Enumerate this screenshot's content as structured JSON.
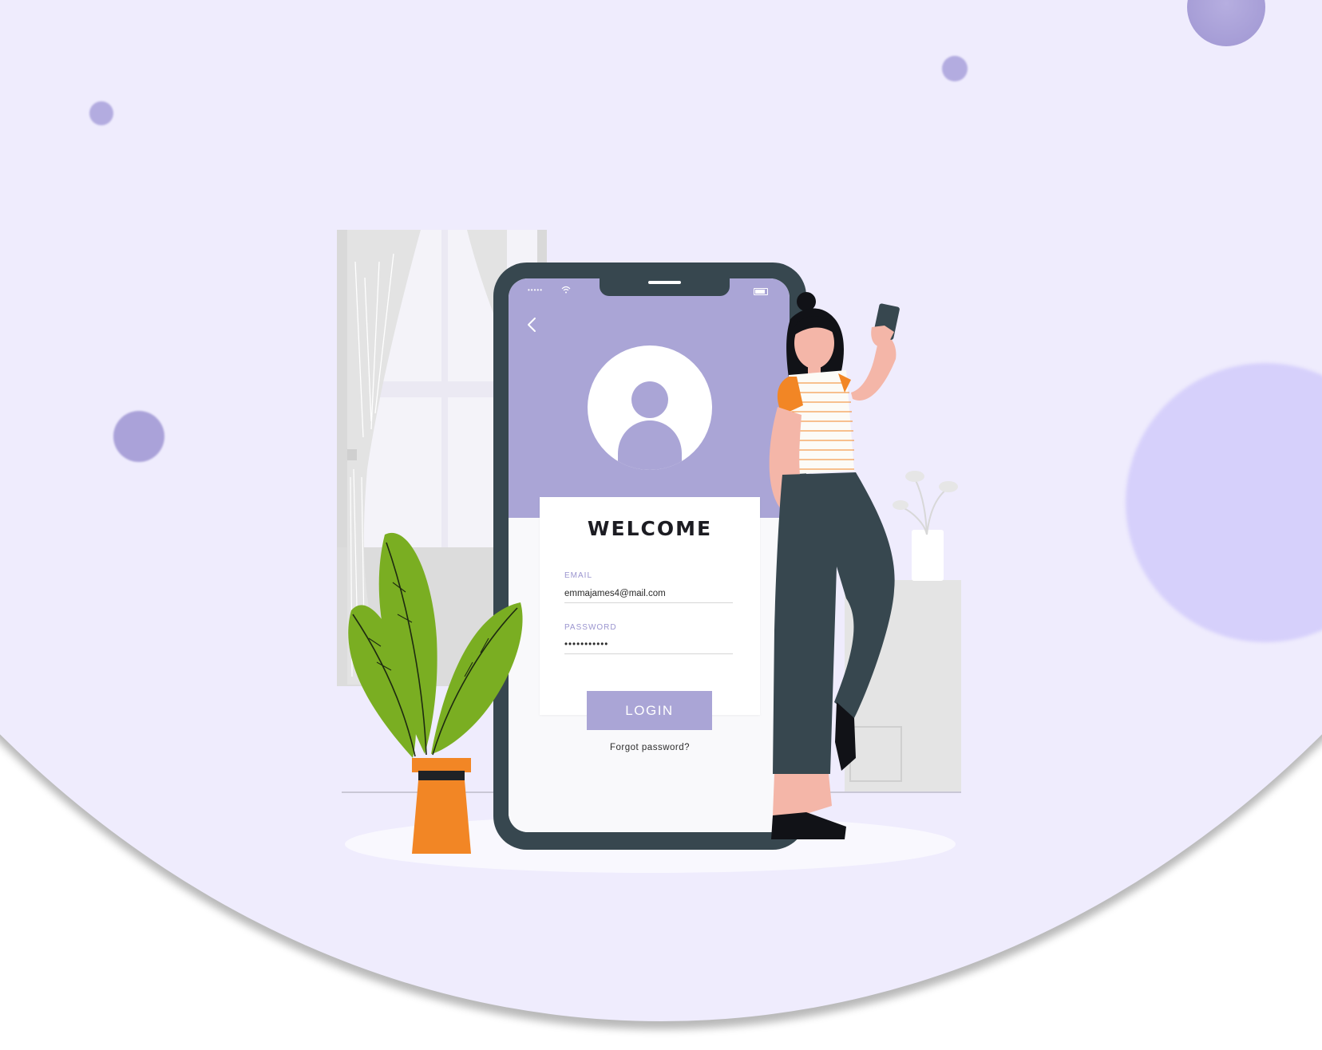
{
  "login_screen": {
    "title": "WELCOME",
    "email": {
      "label": "EMAIL",
      "value": "emmajames4@mail.com"
    },
    "password": {
      "label": "PASSWORD",
      "value": "•••••••••••"
    },
    "login_label": "LOGIN",
    "forgot_label": "Forgot password?",
    "status_bar": {
      "signal": "•••••"
    }
  },
  "colors": {
    "background": "#efecfd",
    "accent": "#aaa5d6",
    "phone_body": "#37474f",
    "label_text": "#9b95cf",
    "plant_green": "#7aae22",
    "pot_orange": "#f28625"
  },
  "icons": {
    "back": "chevron-left-icon",
    "avatar": "user-avatar-icon",
    "wifi": "wifi-icon",
    "battery": "battery-icon"
  }
}
